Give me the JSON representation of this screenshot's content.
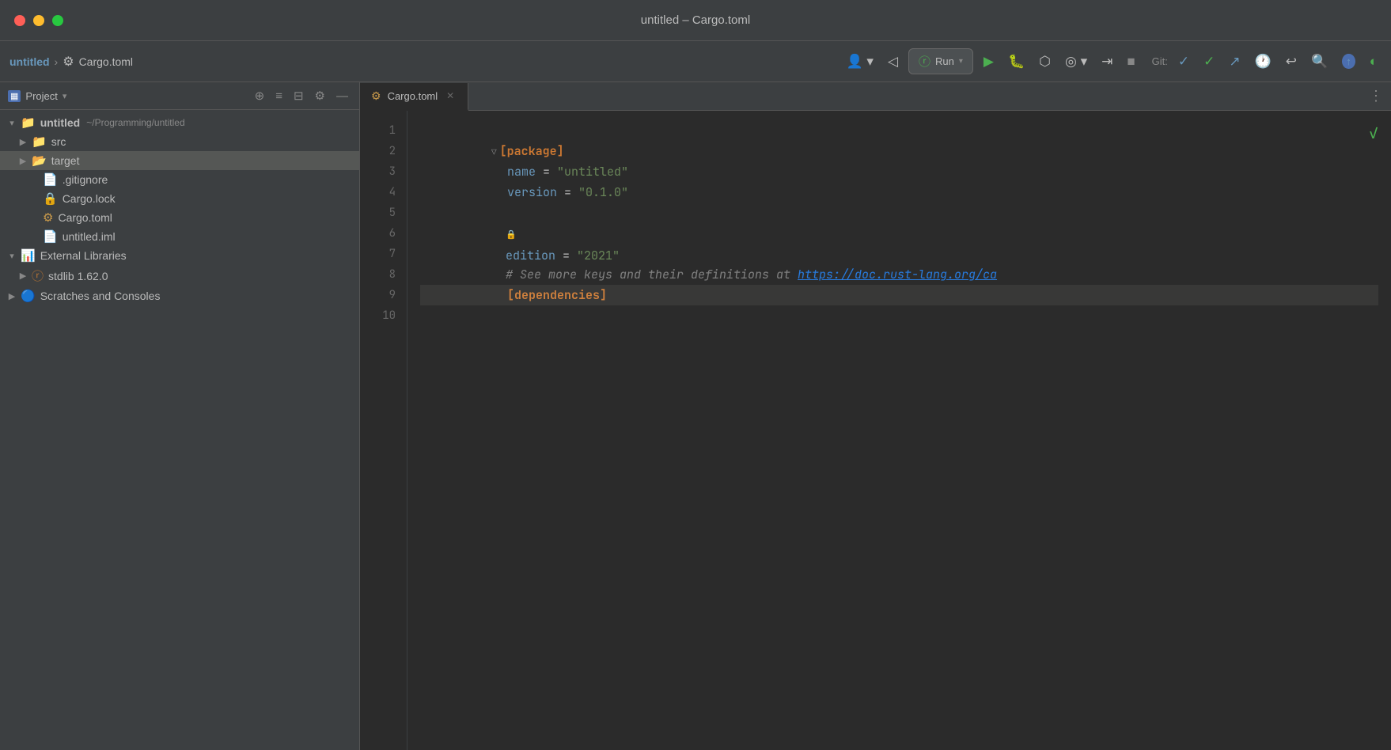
{
  "window": {
    "title": "untitled – Cargo.toml"
  },
  "titlebar": {
    "controls": {
      "close": "●",
      "minimize": "●",
      "maximize": "●"
    }
  },
  "toolbar": {
    "project_name": "untitled",
    "separator": "›",
    "file_name": "Cargo.toml",
    "run_label": "Run",
    "git_label": "Git:"
  },
  "sidebar": {
    "header": "Project",
    "items": [
      {
        "id": "root",
        "label": "untitled",
        "path": "~/Programming/untitled",
        "type": "root",
        "expanded": true,
        "indent": 0
      },
      {
        "id": "src",
        "label": "src",
        "type": "folder",
        "expanded": false,
        "indent": 1
      },
      {
        "id": "target",
        "label": "target",
        "type": "folder-orange",
        "expanded": false,
        "indent": 1,
        "selected": true
      },
      {
        "id": "gitignore",
        "label": ".gitignore",
        "type": "file",
        "indent": 2
      },
      {
        "id": "cargo-lock",
        "label": "Cargo.lock",
        "type": "lock-file",
        "indent": 2
      },
      {
        "id": "cargo-toml",
        "label": "Cargo.toml",
        "type": "toml-file",
        "indent": 2
      },
      {
        "id": "untitled-iml",
        "label": "untitled.iml",
        "type": "iml-file",
        "indent": 2
      },
      {
        "id": "ext-libs",
        "label": "External Libraries",
        "type": "ext-libs",
        "expanded": true,
        "indent": 0
      },
      {
        "id": "stdlib",
        "label": "stdlib 1.62.0",
        "type": "rust-lib",
        "expanded": false,
        "indent": 1
      },
      {
        "id": "scratches",
        "label": "Scratches and Consoles",
        "type": "scratches",
        "expanded": false,
        "indent": 0
      }
    ]
  },
  "editor": {
    "tab_name": "Cargo.toml",
    "lines": [
      {
        "num": 1,
        "content": "[package]",
        "type": "section"
      },
      {
        "num": 2,
        "content": "name = \"untitled\"",
        "type": "kv-string"
      },
      {
        "num": 3,
        "content": "version = \"0.1.0\"",
        "type": "kv-string"
      },
      {
        "num": 4,
        "content": "edition = \"2021\"",
        "type": "kv-string"
      },
      {
        "num": 5,
        "content": "",
        "type": "empty"
      },
      {
        "num": 6,
        "content": "# See more keys and their definitions at https://doc.rust-lang.org/ca",
        "type": "comment"
      },
      {
        "num": 7,
        "content": "",
        "type": "empty"
      },
      {
        "num": 8,
        "content": "[dependencies]",
        "type": "section"
      },
      {
        "num": 9,
        "content": "",
        "type": "empty",
        "current": true
      },
      {
        "num": 10,
        "content": "",
        "type": "empty"
      }
    ],
    "comment_url": "https://doc.rust-lang.org/ca"
  }
}
